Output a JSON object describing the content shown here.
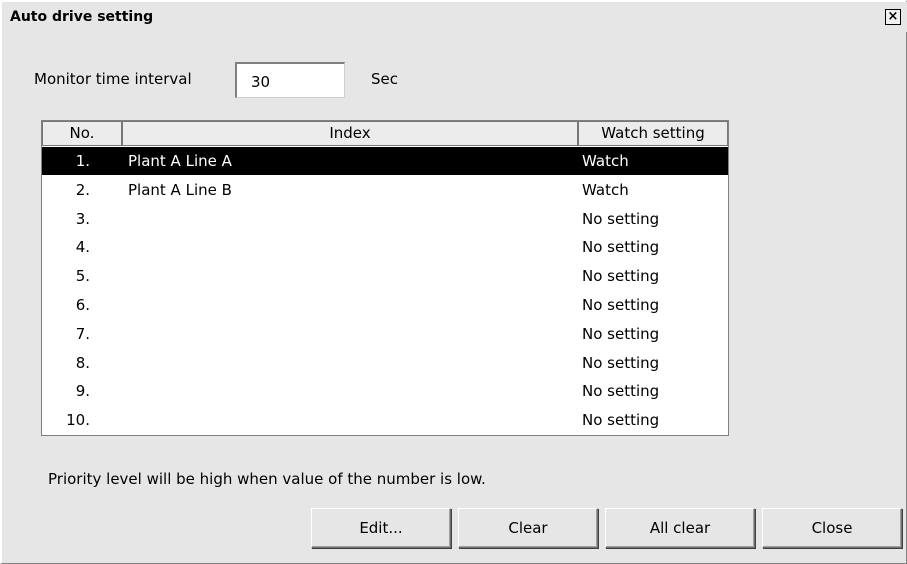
{
  "window": {
    "title": "Auto drive setting",
    "close_glyph": "×"
  },
  "monitor": {
    "label": "Monitor time interval",
    "value": "30",
    "unit": "Sec"
  },
  "table": {
    "headers": [
      "No.",
      "Index",
      "Watch setting"
    ],
    "rows": [
      {
        "no": "1.",
        "index": "Plant A Line A",
        "watch": "Watch",
        "selected": true
      },
      {
        "no": "2.",
        "index": "Plant A Line B",
        "watch": "Watch",
        "selected": false
      },
      {
        "no": "3.",
        "index": "",
        "watch": "No setting",
        "selected": false
      },
      {
        "no": "4.",
        "index": "",
        "watch": "No setting",
        "selected": false
      },
      {
        "no": "5.",
        "index": "",
        "watch": "No setting",
        "selected": false
      },
      {
        "no": "6.",
        "index": "",
        "watch": "No setting",
        "selected": false
      },
      {
        "no": "7.",
        "index": "",
        "watch": "No setting",
        "selected": false
      },
      {
        "no": "8.",
        "index": "",
        "watch": "No setting",
        "selected": false
      },
      {
        "no": "9.",
        "index": "",
        "watch": "No setting",
        "selected": false
      },
      {
        "no": "10.",
        "index": "",
        "watch": "No setting",
        "selected": false
      }
    ]
  },
  "note": "Priority level will be high when value of the number is low.",
  "buttons": {
    "edit": "Edit...",
    "clear": "Clear",
    "all_clear": "All clear",
    "close": "Close"
  },
  "colors": {
    "background": "#e6e6e6",
    "selected_row_bg": "#000000",
    "selected_row_fg": "#ffffff"
  }
}
